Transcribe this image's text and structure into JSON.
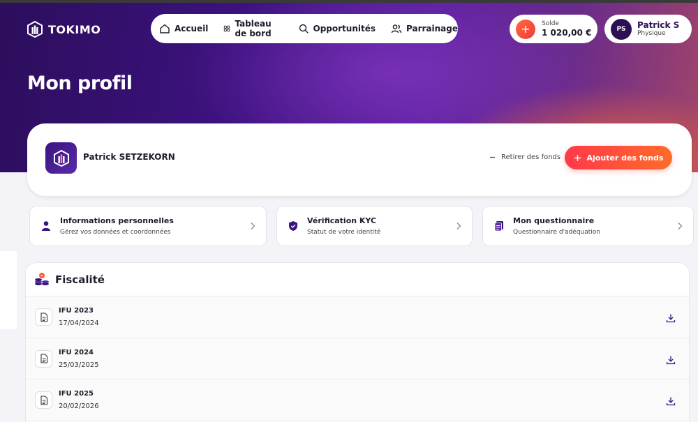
{
  "brand": {
    "name": "TOKIMO"
  },
  "nav": {
    "items": [
      {
        "label": "Accueil",
        "icon": "home-icon"
      },
      {
        "label": "Tableau de bord",
        "icon": "dashboard-icon"
      },
      {
        "label": "Opportunités",
        "icon": "search-icon"
      },
      {
        "label": "Parrainage",
        "icon": "users-icon"
      }
    ]
  },
  "balance": {
    "label": "Solde",
    "value": "1 020,00 €",
    "add_symbol": "+"
  },
  "user": {
    "initials": "PS",
    "name": "Patrick S",
    "type": "Physique"
  },
  "page": {
    "title": "Mon profil"
  },
  "profile": {
    "name": "Patrick SETZEKORN",
    "withdraw_label": "Retirer des fonds",
    "add_funds_label": "Ajouter des fonds"
  },
  "features": [
    {
      "title": "Informations personnelles",
      "subtitle": "Gérez vos données et coordonnées",
      "icon": "person-icon"
    },
    {
      "title": "Vérification KYC",
      "subtitle": "Statut de votre identité",
      "icon": "shield-check-icon"
    },
    {
      "title": "Mon questionnaire",
      "subtitle": "Questionnaire d'adéquation",
      "icon": "clipboard-icon"
    }
  ],
  "fiscal": {
    "title": "Fiscalité",
    "documents": [
      {
        "title": "IFU 2023",
        "date": "17/04/2024"
      },
      {
        "title": "IFU 2024",
        "date": "25/03/2025"
      },
      {
        "title": "IFU 2025",
        "date": "20/02/2026"
      }
    ]
  },
  "colors": {
    "accent_orange": "#ff5a3a",
    "brand_purple": "#2d1054",
    "hero_purple": "#3d1280"
  }
}
